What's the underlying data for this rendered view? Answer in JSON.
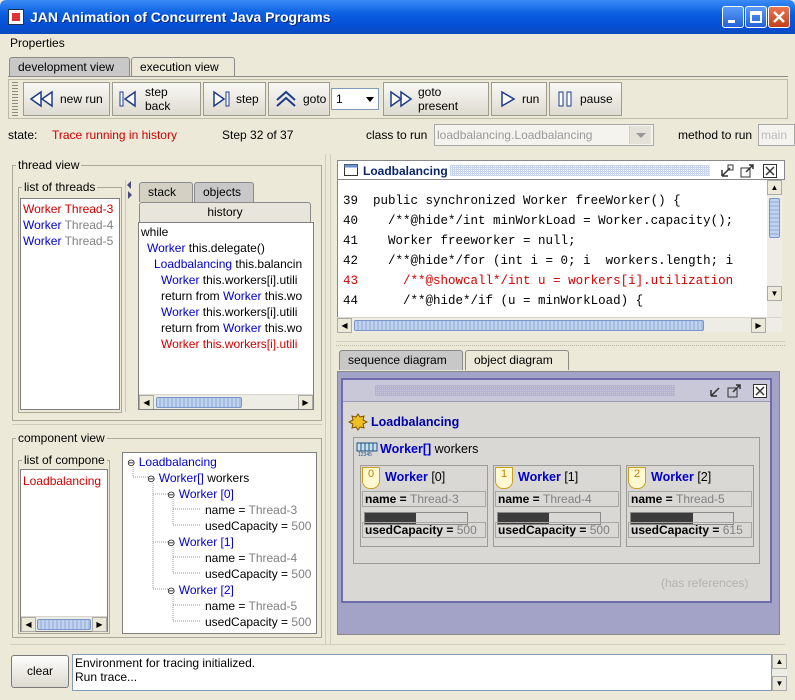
{
  "window": {
    "title": "JAN Animation of Concurrent Java Programs",
    "controls": [
      "minimize-icon",
      "maximize-icon",
      "close-icon"
    ]
  },
  "menu": {
    "properties": "Properties"
  },
  "main_tabs": [
    {
      "label": "development view",
      "active": false
    },
    {
      "label": "execution view",
      "active": true
    }
  ],
  "toolbar": {
    "new_run": "new run",
    "step_back": "step back",
    "step": "step",
    "goto": "goto",
    "goto_value": "1",
    "goto_present": "goto present",
    "run": "run",
    "pause": "pause"
  },
  "state_row": {
    "state_label": "state:",
    "state_value": "Trace running in history",
    "step_info": "Step 32 of 37",
    "class_label": "class to run",
    "class_value": "loadbalancing.Loadbalancing",
    "method_label": "method to run",
    "method_value": "main"
  },
  "thread_view": {
    "title": "thread view",
    "list_title": "list of threads",
    "threads": [
      {
        "type": "Worker",
        "name": "Thread-3",
        "selected": true
      },
      {
        "type": "Worker",
        "name": "Thread-4",
        "selected": false
      },
      {
        "type": "Worker",
        "name": "Thread-5",
        "selected": false
      }
    ],
    "tabs": {
      "stack": "stack",
      "objects": "objects",
      "history": "history"
    },
    "history": [
      {
        "prefix": "",
        "type": "",
        "text": "while"
      },
      {
        "prefix": "",
        "type": "Worker",
        "text": " this.delegate()"
      },
      {
        "prefix": "",
        "type": "Loadbalancing",
        "text": " this.balancin"
      },
      {
        "prefix": "",
        "type": "Worker",
        "text": " this.workers[i].utili"
      },
      {
        "prefix": "return from ",
        "type": "Worker",
        "text": " this.wo"
      },
      {
        "prefix": "",
        "type": "Worker",
        "text": " this.workers[i].utili"
      },
      {
        "prefix": "return from ",
        "type": "Worker",
        "text": " this.wo"
      },
      {
        "prefix": "",
        "type": "Worker",
        "text": " this.workers[i].utili"
      }
    ]
  },
  "component_view": {
    "title": "component view",
    "list_title": "list of compone",
    "components": [
      "Loadbalancing"
    ],
    "tree": {
      "root": "Loadbalancing",
      "array_type": "Worker[]",
      "array_name": " workers",
      "workers": [
        {
          "label": "Worker",
          "index": " [0]",
          "name_label": "name = ",
          "name": "Thread-3",
          "cap_label": "usedCapacity = ",
          "cap": "500"
        },
        {
          "label": "Worker",
          "index": " [1]",
          "name_label": "name = ",
          "name": "Thread-4",
          "cap_label": "usedCapacity = ",
          "cap": "500"
        },
        {
          "label": "Worker",
          "index": " [2]",
          "name_label": "name = ",
          "name": "Thread-5",
          "cap_label": "usedCapacity = ",
          "cap": "500"
        }
      ]
    }
  },
  "code_panel": {
    "title": "Loadbalancing",
    "lines": [
      {
        "num": "39",
        "code": "public synchronized Worker freeWorker() {",
        "highlight": false
      },
      {
        "num": "40",
        "code": "  /**@hide*/int minWorkLoad = Worker.capacity();",
        "highlight": false
      },
      {
        "num": "41",
        "code": "  Worker freeworker = null;",
        "highlight": false
      },
      {
        "num": "42",
        "code": "  /**@hide*/for (int i = 0; i  workers.length; i",
        "highlight": false
      },
      {
        "num": "43",
        "code": "    /**@showcall*/int u = workers[i].utilization",
        "highlight": true
      },
      {
        "num": "44",
        "code": "    /**@hide*/if (u = minWorkLoad) {",
        "highlight": false
      }
    ]
  },
  "diagram_tabs": {
    "sequence": "sequence diagram",
    "object": "object diagram"
  },
  "object_diagram": {
    "root": "Loadbalancing",
    "array_type": "Worker[]",
    "array_name": " workers",
    "objects": [
      {
        "badge": "0",
        "type": "Worker",
        "index": " [0]",
        "name_label": "name = ",
        "name": "Thread-3",
        "cap_label": "usedCapacity = ",
        "cap": "500",
        "load_fraction": 0.5
      },
      {
        "badge": "1",
        "type": "Worker",
        "index": " [1]",
        "name_label": "name = ",
        "name": "Thread-4",
        "cap_label": "usedCapacity = ",
        "cap": "500",
        "load_fraction": 0.5
      },
      {
        "badge": "2",
        "type": "Worker",
        "index": " [2]",
        "name_label": "name = ",
        "name": "Thread-5",
        "cap_label": "usedCapacity = ",
        "cap": "615",
        "load_fraction": 0.61
      }
    ],
    "note": "(has references)"
  },
  "log": {
    "clear": "clear",
    "lines": [
      "Environment for tracing initialized.",
      "Run trace..."
    ]
  },
  "colors": {
    "type_blue": "#0000cc",
    "selected_red": "#cc0000",
    "diagram_bg": "#a3a3c8",
    "titlebar_blue": "#0a5fe0"
  }
}
